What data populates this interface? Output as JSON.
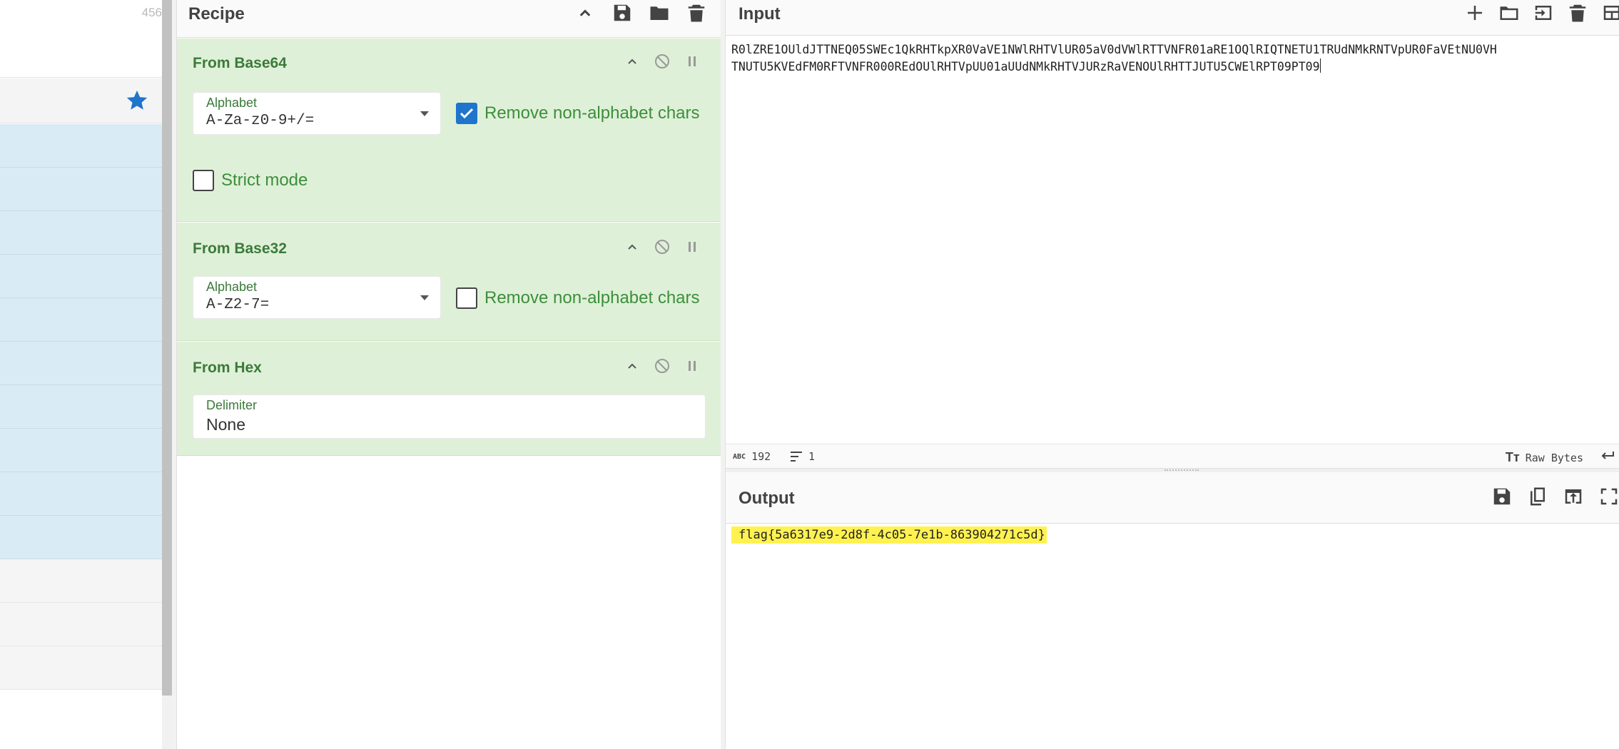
{
  "operations": {
    "count": "456",
    "favourites_icon": "star-icon"
  },
  "recipe": {
    "title": "Recipe",
    "icons": [
      "chevron-up-icon",
      "save-icon",
      "folder-icon",
      "trash-icon"
    ],
    "ops": [
      {
        "name": "From Base64",
        "alphabet_label": "Alphabet",
        "alphabet_value": "A-Za-z0-9+/=",
        "remove_label": "Remove non-alphabet chars",
        "remove_checked": true,
        "strict_label": "Strict mode",
        "strict_checked": false
      },
      {
        "name": "From Base32",
        "alphabet_label": "Alphabet",
        "alphabet_value": "A-Z2-7=",
        "remove_label": "Remove non-alphabet chars",
        "remove_checked": false
      },
      {
        "name": "From Hex",
        "delimiter_label": "Delimiter",
        "delimiter_value": "None"
      }
    ]
  },
  "input": {
    "title": "Input",
    "line1": "R0lZRE1OUldJTTNEQ05SWEc1QkRHTkpXR0VaVE1NWlRHTVlUR05aV0dVWlRTTVNFR01aRE1OQlRIQTNETU1TRUdNMkRNTVpUR0FaVEtNU0VH",
    "line2": "TNUTU5KVEdFM0RFTVNFR000REdOUlRHTVpUU01aUUdNMkRHTVJURzRaVENOUlRHTTJUTU5CWElRPT09PT09",
    "length": "192",
    "lines": "1",
    "encoding": "Raw Bytes",
    "icons": [
      "plus-icon",
      "open-folder-icon",
      "import-icon",
      "trash-icon",
      "layout-icon"
    ]
  },
  "output": {
    "title": "Output",
    "value": "flag{5a6317e9-2d8f-4c05-7e1b-863904271c5d}",
    "icons": [
      "save-icon",
      "copy-icon",
      "replace-input-icon",
      "maximize-icon"
    ]
  }
}
